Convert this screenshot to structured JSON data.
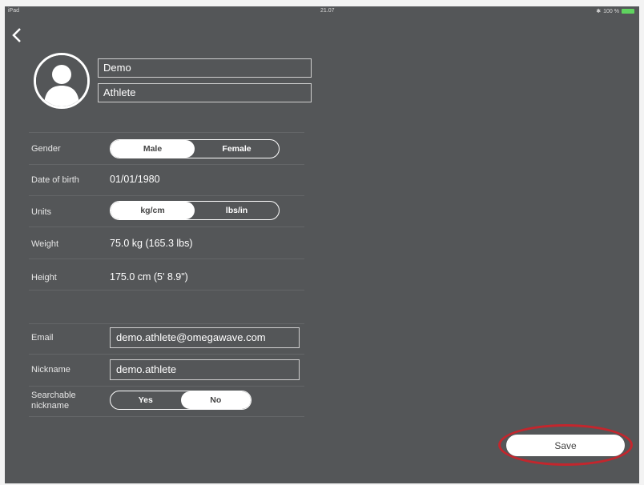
{
  "status_bar": {
    "carrier": "iPad",
    "time": "21.07",
    "battery": "100 %"
  },
  "profile": {
    "first_name": "Demo",
    "last_name": "Athlete"
  },
  "gender": {
    "label": "Gender",
    "options": [
      "Male",
      "Female"
    ],
    "selected": "Male"
  },
  "date_of_birth": {
    "label": "Date of birth",
    "value": "01/01/1980"
  },
  "units": {
    "label": "Units",
    "options": [
      "kg/cm",
      "lbs/in"
    ],
    "selected": "kg/cm"
  },
  "weight": {
    "label": "Weight",
    "value": "75.0 kg (165.3 lbs)"
  },
  "height": {
    "label": "Height",
    "value": "175.0 cm (5' 8.9\")"
  },
  "email": {
    "label": "Email",
    "value": "demo.athlete@omegawave.com"
  },
  "nickname": {
    "label": "Nickname",
    "value": "demo.athlete"
  },
  "searchable": {
    "label_line1": "Searchable",
    "label_line2": "nickname",
    "options": [
      "Yes",
      "No"
    ],
    "selected": "No"
  },
  "save": {
    "label": "Save"
  },
  "colors": {
    "background": "#545658",
    "highlight_ring": "#c3262d",
    "battery": "#5fd35f"
  }
}
